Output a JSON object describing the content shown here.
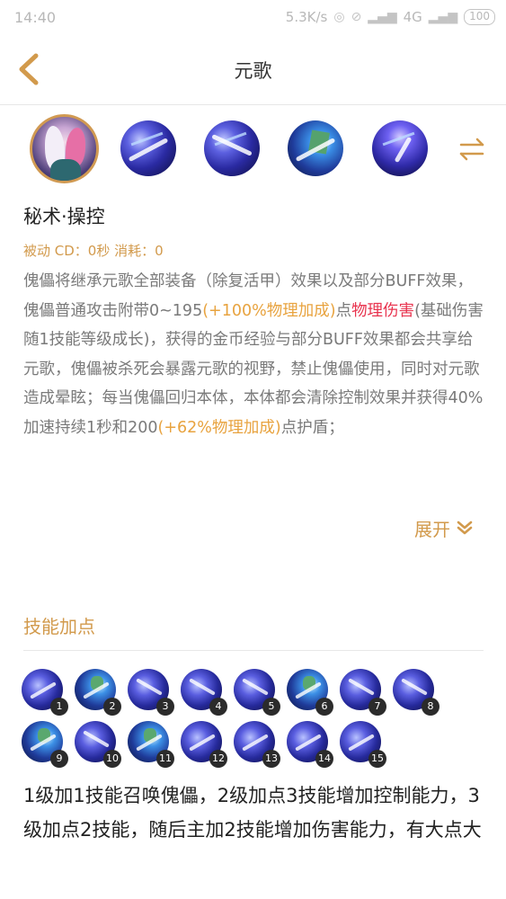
{
  "status_bar": {
    "time": "14:40",
    "network_speed": "5.3K/s",
    "network_type": "4G",
    "battery": "100"
  },
  "header": {
    "title": "元歌"
  },
  "skills_row": {
    "icons": [
      "hero-portrait",
      "skill-1-icon",
      "skill-2-icon",
      "skill-3-icon",
      "passive-icon"
    ]
  },
  "skill": {
    "name": "秘术·操控",
    "meta": "被动 CD：0秒 消耗：0",
    "desc": {
      "p1": "傀儡将继承元歌全部装备（除复活甲）效果以及部分BUFF效果，傀儡普通攻击附带0~195",
      "p2": "(+100%物理加成)",
      "p3": "点",
      "p4": "物理伤害",
      "p5": "(基础伤害随1技能等级成长)，获得的金币经验与部分BUFF效果都会共享给元歌，傀儡被杀死会暴露元歌的视野，禁止傀儡使用，同时对元歌造成晕眩；每当傀儡回归本体，本体都会清除控制效果并获得40%加速持续1秒和200",
      "p6": "(+62%物理加成)",
      "p7": "点护盾；"
    }
  },
  "expand_label": "展开",
  "leveling": {
    "title": "技能加点",
    "levels": [
      {
        "n": "1",
        "skill": 1
      },
      {
        "n": "2",
        "skill": 3
      },
      {
        "n": "3",
        "skill": 2
      },
      {
        "n": "4",
        "skill": 2
      },
      {
        "n": "5",
        "skill": 2
      },
      {
        "n": "6",
        "skill": 3
      },
      {
        "n": "7",
        "skill": 2
      },
      {
        "n": "8",
        "skill": 2
      },
      {
        "n": "9",
        "skill": 3
      },
      {
        "n": "10",
        "skill": 2
      },
      {
        "n": "11",
        "skill": 3
      },
      {
        "n": "12",
        "skill": 1
      },
      {
        "n": "13",
        "skill": 1
      },
      {
        "n": "14",
        "skill": 1
      },
      {
        "n": "15",
        "skill": 1
      }
    ],
    "note": "1级加1技能召唤傀儡，2级加点3技能增加控制能力，3级加点2技能，随后主加2技能增加伤害能力，有大点大"
  },
  "colors": {
    "accent": "#d29a4c",
    "bonus_orange": "#e8a33f",
    "damage_red": "#e8334e"
  }
}
